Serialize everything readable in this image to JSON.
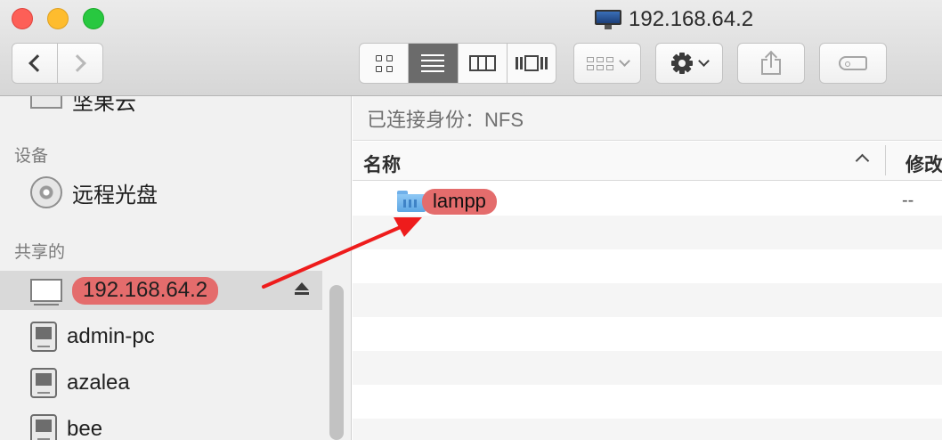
{
  "window": {
    "title": "192.168.64.2"
  },
  "toolbar": {
    "back_icon": "chevron-left-icon",
    "forward_icon": "chevron-right-icon",
    "views": [
      "icon-view",
      "list-view",
      "column-view",
      "cover-flow-view"
    ],
    "active_view": "list-view"
  },
  "sidebar": {
    "partial_item": {
      "label": "坚果云",
      "icon": "cloud-drive-icon"
    },
    "sections": [
      {
        "title": "设备",
        "items": [
          {
            "label": "远程光盘",
            "icon": "disc-icon"
          }
        ]
      },
      {
        "title": "共享的",
        "items": [
          {
            "label": "192.168.64.2",
            "icon": "display-icon",
            "selected": true,
            "eject": true
          },
          {
            "label": "admin-pc",
            "icon": "pc-icon"
          },
          {
            "label": "azalea",
            "icon": "pc-icon"
          },
          {
            "label": "bee",
            "icon": "pc-icon"
          }
        ]
      }
    ]
  },
  "content": {
    "connected_as": "已连接身份：NFS",
    "columns": {
      "name": "名称",
      "modified": "修改"
    },
    "files": [
      {
        "name": "lampp",
        "modified": "--",
        "icon": "shared-folder-icon"
      }
    ]
  },
  "colors": {
    "highlight": "#e46c6c",
    "annotation_arrow": "#ee1c1c"
  }
}
